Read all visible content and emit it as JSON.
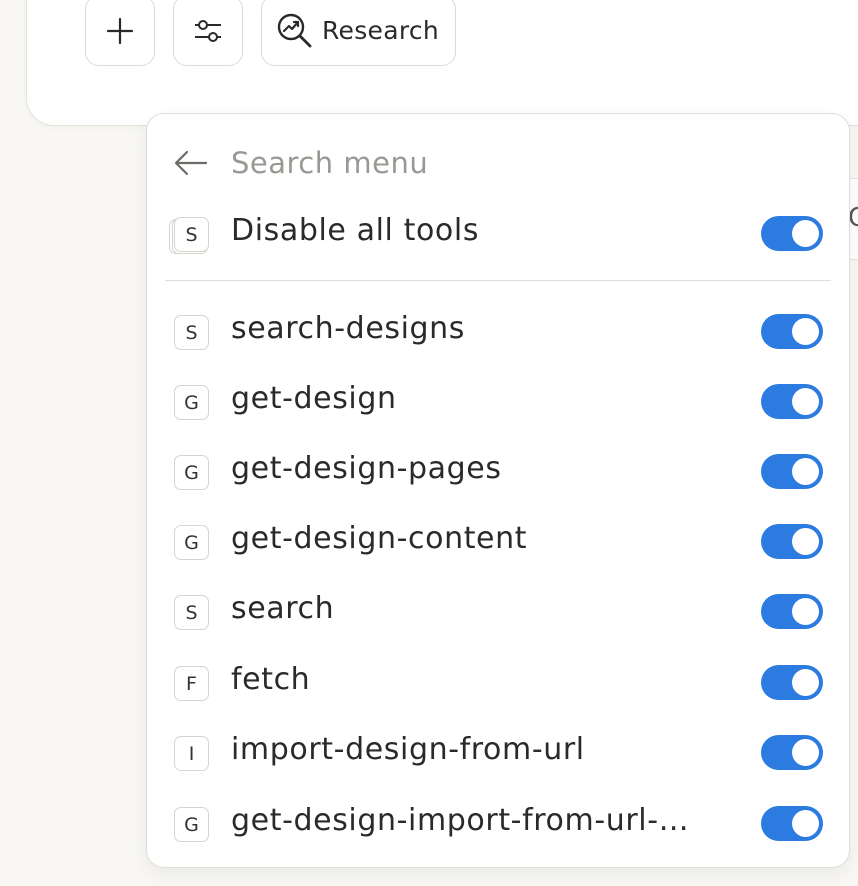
{
  "composer": {
    "buttons": {
      "add_icon": "plus-icon",
      "tools_icon": "sliders-icon",
      "research_label": "Research",
      "research_icon": "chart-magnifier-icon"
    }
  },
  "menu": {
    "search": {
      "placeholder": "Search menu",
      "value": ""
    },
    "disable_all": {
      "badge": "S",
      "label": "Disable all tools",
      "enabled": true
    },
    "tools": [
      {
        "badge": "S",
        "label": "search-designs",
        "enabled": true
      },
      {
        "badge": "G",
        "label": "get-design",
        "enabled": true
      },
      {
        "badge": "G",
        "label": "get-design-pages",
        "enabled": true
      },
      {
        "badge": "G",
        "label": "get-design-content",
        "enabled": true
      },
      {
        "badge": "S",
        "label": "search",
        "enabled": true
      },
      {
        "badge": "F",
        "label": "fetch",
        "enabled": true
      },
      {
        "badge": "I",
        "label": "import-design-from-url",
        "enabled": true
      },
      {
        "badge": "G",
        "label": "get-design-import-from-url-…",
        "enabled": true
      }
    ]
  },
  "colors": {
    "toggle_on": "#2c7be0",
    "background": "#f8f7f4"
  }
}
